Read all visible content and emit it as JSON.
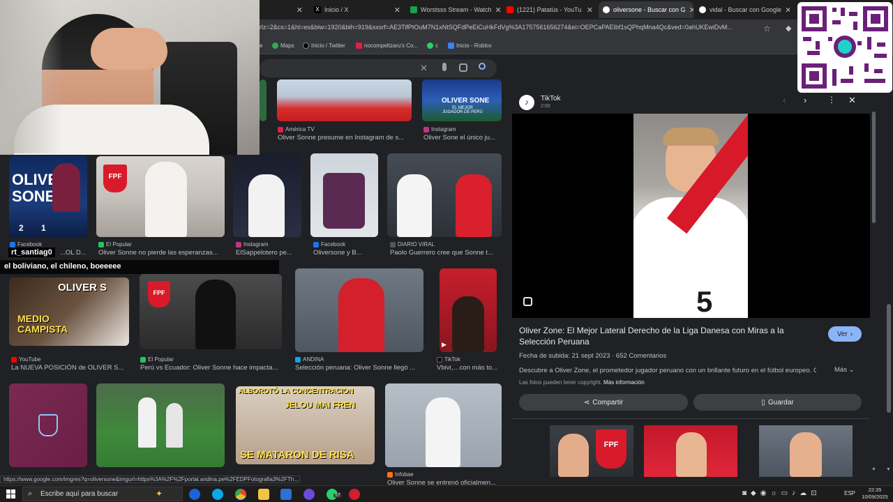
{
  "tabs": [
    {
      "label": "Inicio / X",
      "color": "#000000"
    },
    {
      "label": "Worstsss Stream - Watch",
      "color": "#16a34a"
    },
    {
      "label": "(1221) Patatús - YouTu",
      "color": "#ff0000"
    },
    {
      "label": "oliversone - Buscar con G",
      "color": "#4285f4"
    },
    {
      "label": "vidal - Buscar con Google",
      "color": "#4285f4"
    }
  ],
  "address_bar": {
    "url": "rlz=2&cs=1&hl=es&biw=1920&bih=919&sxsrf=AE3TifPtOuM7N1xNtSQFdPeEiCuHkFdVg%3A1757561656274&ei=OEPCaPAEIbf1sQPhqMna4Qc&ved=0ahUKEwiDvM..."
  },
  "bookmarks": [
    {
      "label": "e",
      "color": "#888888"
    },
    {
      "label": "Maps",
      "color": "#34a853"
    },
    {
      "label": "Inicio / Twitter",
      "color": "#000000"
    },
    {
      "label": "nocompeltzaru's Co...",
      "color": "#e11d48"
    },
    {
      "label": "c",
      "color": "#25d366"
    },
    {
      "label": "Inicio - Roblox",
      "color": "#3b82f6"
    }
  ],
  "chat": {
    "username": "rt_santiag0",
    "message": "el boliviano, el chileno, boeeeee"
  },
  "results": [
    {
      "source": "América TV",
      "caption": "Oliver Sonne presume en Instagram de s...",
      "icon_color": "#e11d48"
    },
    {
      "source": "Instagram",
      "caption": "Oliver Sone el único ju...",
      "icon_color": "#c13584"
    },
    {
      "source": "Facebook",
      "caption": "...OL D...",
      "icon_color": "#1877f2"
    },
    {
      "source": "El Popular",
      "caption": "Oliver Sonne no pierde las esperanzas...",
      "icon_color": "#22c55e"
    },
    {
      "source": "Instagram",
      "caption": "ElSappelotero pe...",
      "icon_color": "#c13584"
    },
    {
      "source": "Facebook",
      "caption": "Oliversone y B...",
      "icon_color": "#1877f2"
    },
    {
      "source": "DIARIO VIRAL",
      "caption": "Paolo Guerrero cree que Sonne t...",
      "icon_color": "#555555"
    },
    {
      "source": "YouTube",
      "caption": "La NUEVA POSICIÓN de OLIVER S...",
      "icon_color": "#ff0000"
    },
    {
      "source": "El Popular",
      "caption": "Perú vs Ecuador: Oliver Sonne hace impacta...",
      "icon_color": "#22c55e"
    },
    {
      "source": "ANDINA",
      "caption": "Selección peruana: Oliver Sonne llegó ...",
      "icon_color": "#0ea5e9"
    },
    {
      "source": "TikTok",
      "caption": "Vbivi,…con más to...",
      "icon_color": "#111111"
    },
    {
      "source": "Infobae",
      "caption": "Oliver Sonne se entrenó oficialmen...",
      "icon_color": "#f97316"
    }
  ],
  "thumb_text": {
    "oliver_sone_top": "OLIVER SONE",
    "oliver_sone_sub": "EL MEJOR JUGADOR DE PERÚ",
    "left_card": "OLIVER SONE",
    "score_left": "2",
    "score_right": "1",
    "medio_campista": "MEDIO CAMPISTA",
    "oliver_s": "OLIVER S",
    "alboroto": "ALBOROTÓ LA CONCENTRACION",
    "jelou": "JELOU MAI FREN",
    "se_mataron": "SE MATARON DE RISA",
    "fpf": "FPF"
  },
  "panel": {
    "source": "TikTok",
    "duration": "2:00",
    "title": "Oliver Zone: El Mejor Lateral Derecho de la Liga Danesa con Miras a la Selección Peruana",
    "view_label": "Ver",
    "meta_date": "Fecha de subida: 21 sept 2023",
    "meta_comments": "652 Comentarios",
    "description": "Descubre a Oliver Zone, el prometedor jugador peruano con un brillante futuro en el fútbol europeo. Cono...",
    "more_label": "Más",
    "copyright": "Las fotos pueden tener copyright.",
    "more_info": "Más información",
    "share_label": "Compartir",
    "save_label": "Guardar",
    "jersey_number": "5"
  },
  "status_url": "https://www.google.com/imgres?q=oliversone&imgurl=https%3A%2F%2Fportal.andina.pe%2FEDPFotografia3%2FTh...",
  "taskbar": {
    "search_placeholder": "Escribe aquí para buscar",
    "badge": "57",
    "language": "ESP",
    "time": "22:35",
    "date": "10/09/2025"
  }
}
